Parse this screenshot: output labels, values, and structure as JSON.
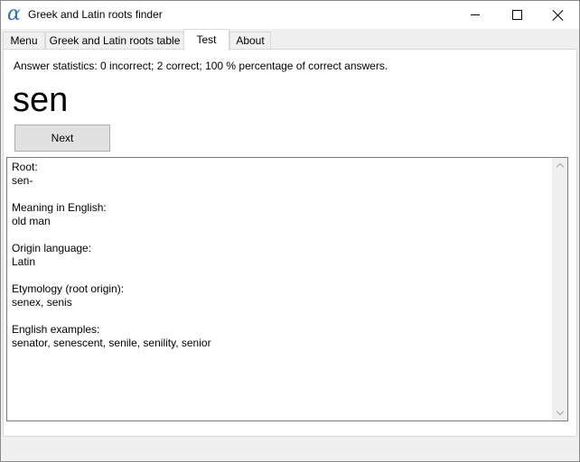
{
  "window": {
    "app_icon": "α",
    "title": "Greek and Latin roots finder"
  },
  "tabs": [
    {
      "label": "Menu"
    },
    {
      "label": "Greek and Latin roots table"
    },
    {
      "label": "Test"
    },
    {
      "label": "About"
    }
  ],
  "active_tab": "Test",
  "test": {
    "stats": "Answer statistics: 0 incorrect; 2 correct; 100 % percentage of correct answers.",
    "root_display": "sen",
    "next_label": "Next"
  },
  "details": {
    "fields": [
      {
        "label": "Root:",
        "value": "sen-"
      },
      {
        "label": "Meaning in English:",
        "value": "old man"
      },
      {
        "label": "Origin language:",
        "value": "Latin"
      },
      {
        "label": "Etymology (root origin):",
        "value": "senex, senis"
      },
      {
        "label": "English examples:",
        "value": "senator, senescent, senile, senility, senior"
      }
    ]
  },
  "icons": {
    "app": "alpha-icon",
    "minimize": "minimize-icon",
    "maximize": "maximize-icon",
    "close": "close-icon",
    "scroll_up": "chevron-up-icon",
    "scroll_down": "chevron-down-icon"
  }
}
